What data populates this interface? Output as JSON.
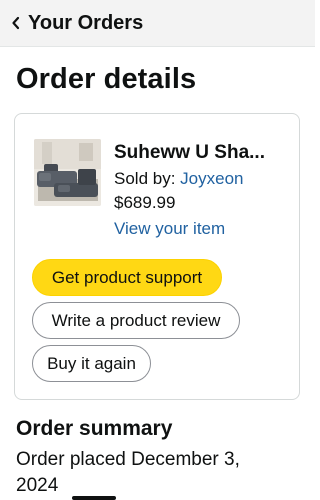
{
  "header": {
    "back_label": "Your Orders",
    "back_icon": "chevron-left-icon",
    "background": "#f3f3f3"
  },
  "page": {
    "title": "Order details"
  },
  "order_item": {
    "product_name": "Suheww U Sha...",
    "sold_by_label": "Sold by: ",
    "seller": "Joyxeon",
    "price": "$689.99",
    "view_item_link": "View your item",
    "image_icon": "sectional-sofa-product-image"
  },
  "actions": {
    "get_support": "Get product support",
    "write_review": "Write a product review",
    "buy_again": "Buy it again"
  },
  "summary": {
    "title": "Order summary",
    "order_placed": "Order placed December 3, 2024"
  },
  "colors": {
    "primary_button": "#ffd814",
    "link": "#2162a1",
    "text": "#0f1111",
    "card_border": "#d5d9d9"
  }
}
